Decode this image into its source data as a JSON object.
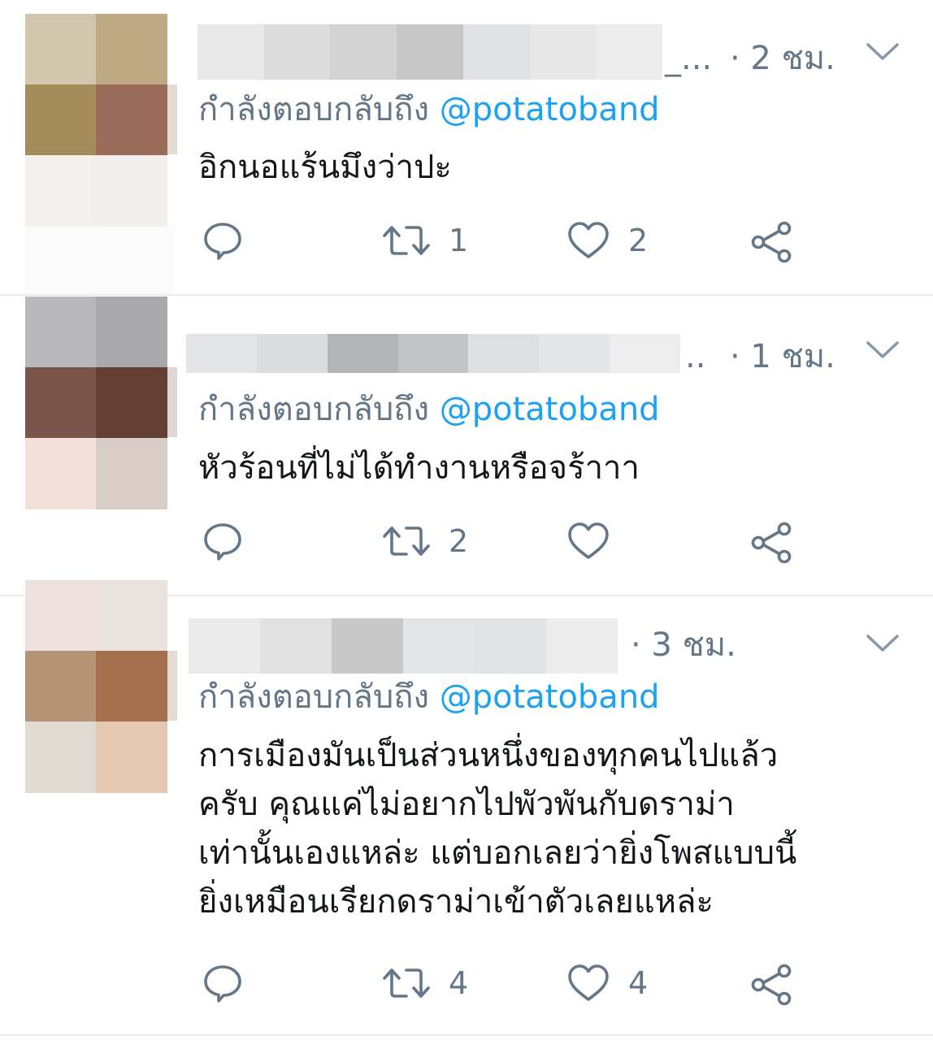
{
  "tweets": [
    {
      "time": "· 2 ชม.",
      "name_tail": "_...",
      "reply_prefix": "กำลังตอบกลับถึง",
      "reply_handle": "@potatoband",
      "text": "อิกนอแร้นมึงว่าปะ",
      "reply_count": "",
      "retweet_count": "1",
      "like_count": "2"
    },
    {
      "time": "· 1 ชม.",
      "name_tail": "..",
      "reply_prefix": "กำลังตอบกลับถึง",
      "reply_handle": "@potatoband",
      "text": "หัวร้อนที่ไม่ได้ทำงานหรือจร้าาา",
      "reply_count": "",
      "retweet_count": "2",
      "like_count": ""
    },
    {
      "time": "· 3 ชม.",
      "name_tail": "",
      "reply_prefix": "กำลังตอบกลับถึง",
      "reply_handle": "@potatoband",
      "text": "การเมืองมันเป็นส่วนหนึ่งของทุกคนไปแล้ว\nครับ คุณแค่ไม่อยากไปพัวพันกับดราม่า\nเท่านั้นเองแหล่ะ แต่บอกเลยว่ายิ่งโพสแบบนี้\nยิ่งเหมือนเรียกดราม่าเข้าตัวเลยแหล่ะ",
      "reply_count": "",
      "retweet_count": "4",
      "like_count": "4"
    }
  ],
  "colors": {
    "mention": "#1da1f2",
    "secondary_text": "#657786",
    "primary_text": "#14171a",
    "divider": "#e6ecf0"
  },
  "icons": [
    "reply-icon",
    "retweet-icon",
    "like-icon",
    "share-icon",
    "chevron-down-icon"
  ]
}
